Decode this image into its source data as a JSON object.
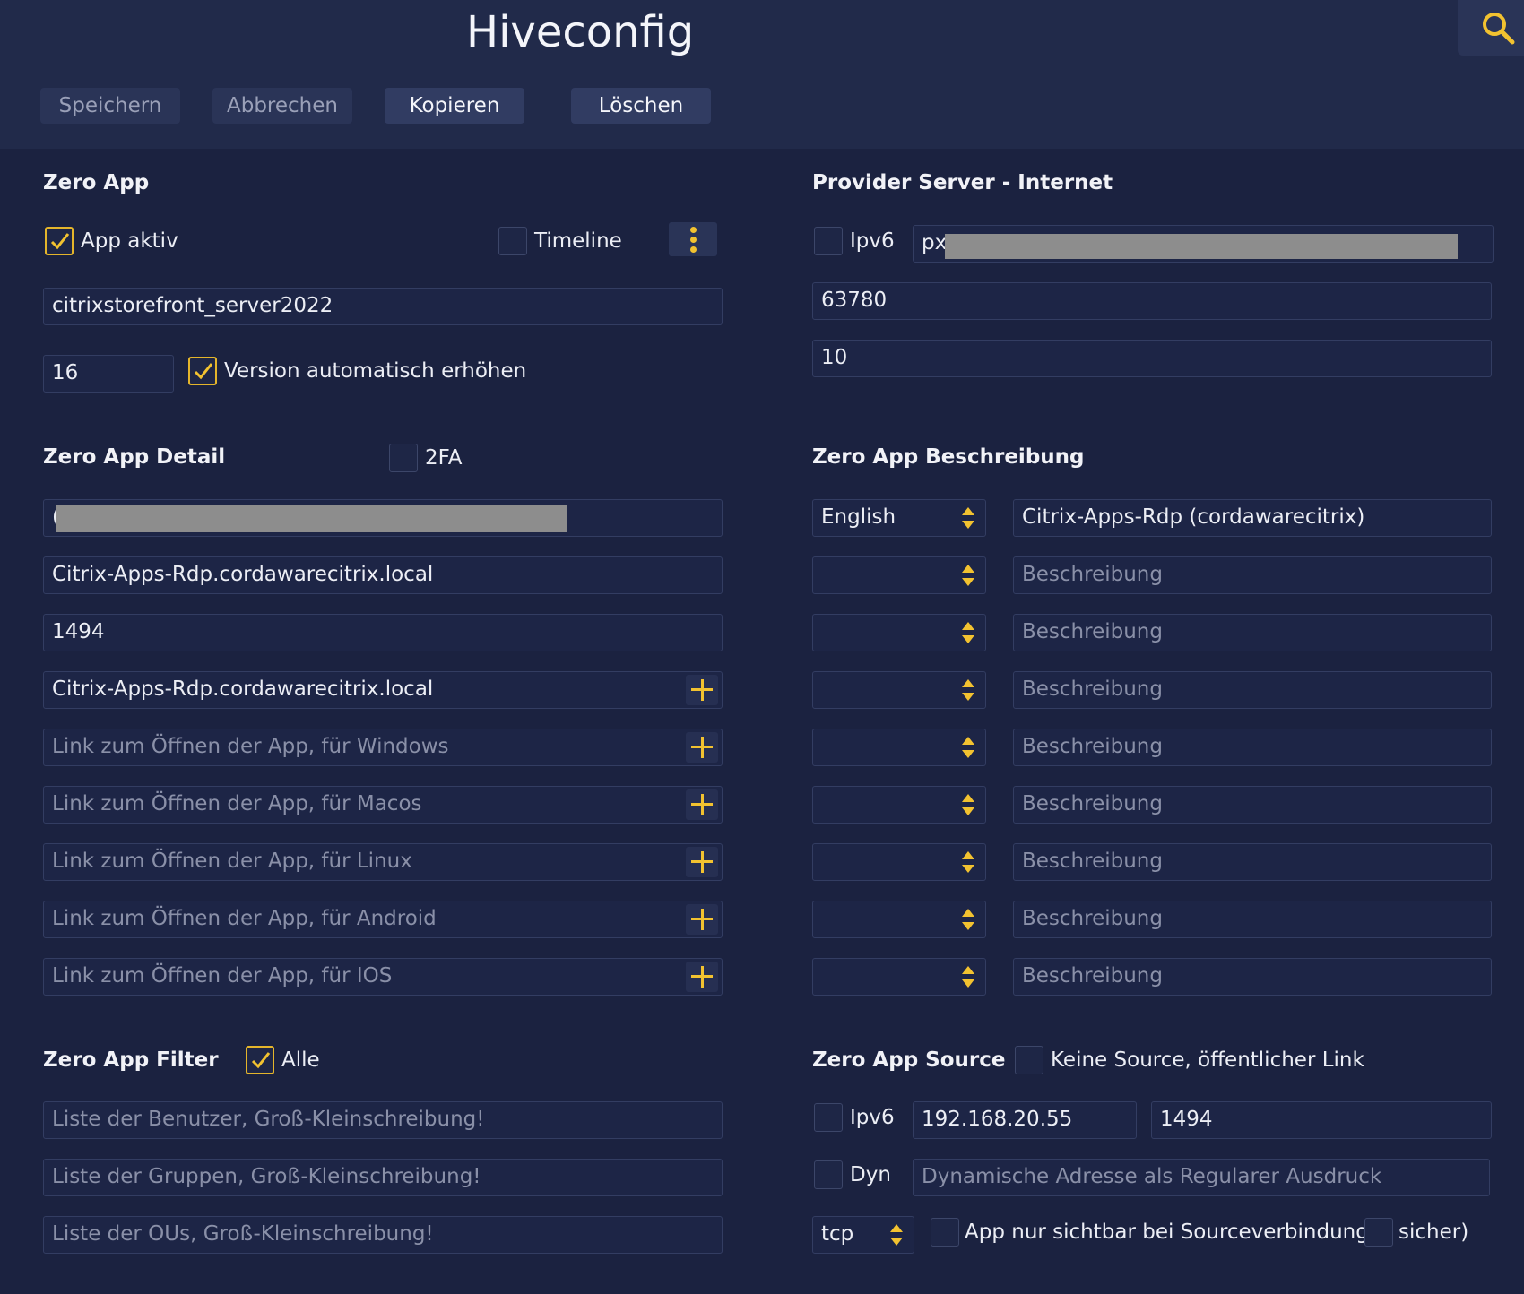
{
  "header": {
    "title": "Hiveconfig",
    "buttons": {
      "save": "Speichern",
      "cancel": "Abbrechen",
      "copy": "Kopieren",
      "delete": "Löschen"
    }
  },
  "zero_app": {
    "title": "Zero App",
    "app_active_label": "App aktiv",
    "app_active_checked": true,
    "timeline_label": "Timeline",
    "timeline_checked": false,
    "name_value": "citrixstorefront_server2022",
    "version_value": "16",
    "auto_version_label": "Version automatisch erhöhen",
    "auto_version_checked": true
  },
  "provider": {
    "title": "Provider Server - Internet",
    "ipv6_label": "Ipv6",
    "ipv6_checked": false,
    "host_value": "px",
    "port_value": "63780",
    "third_value": "10"
  },
  "detail": {
    "title": "Zero App Detail",
    "twofa_label": "2FA",
    "twofa_checked": false,
    "redacted_prefix": "(",
    "host_value": "Citrix-Apps-Rdp.cordawarecitrix.local",
    "port_value": "1494",
    "link_value": "Citrix-Apps-Rdp.cordawarecitrix.local",
    "links": [
      "Link zum Öffnen der App, für Windows",
      "Link zum Öffnen der App, für Macos",
      "Link zum Öffnen der App, für Linux",
      "Link zum Öffnen der App, für Android",
      "Link zum Öffnen der App, für IOS"
    ]
  },
  "description": {
    "title": "Zero App Beschreibung",
    "first_language": "English",
    "first_text": "Citrix-Apps-Rdp (cordawarecitrix)",
    "placeholder": "Beschreibung"
  },
  "filter": {
    "title": "Zero App Filter",
    "all_label": "Alle",
    "all_checked": true,
    "users_placeholder": "Liste der Benutzer, Groß-Kleinschreibung!",
    "groups_placeholder": "Liste der Gruppen, Groß-Kleinschreibung!",
    "ous_placeholder": "Liste der OUs, Groß-Kleinschreibung!"
  },
  "source": {
    "title": "Zero App Source",
    "no_source_label": "Keine Source, öffentlicher Link",
    "no_source_checked": false,
    "ipv6_label": "Ipv6",
    "ipv6_checked": false,
    "ip_value": "192.168.20.55",
    "port_value": "1494",
    "dyn_label": "Dyn",
    "dyn_checked": false,
    "dyn_placeholder": "Dynamische Adresse als Regularer Ausdruck",
    "protocol": "tcp",
    "visible_label": "App nur sichtbar bei Sourceverbindung(",
    "visible_checked": false,
    "secure_label": "sicher)",
    "secure_checked": false
  },
  "colors": {
    "background": "#1b2240",
    "header": "#212a4a",
    "accent": "#f2c230",
    "field_border": "#333d62"
  },
  "icons": [
    "search-icon",
    "kebab-menu-icon",
    "plus-icon",
    "checkmark-icon",
    "spinner-arrows-icon"
  ]
}
